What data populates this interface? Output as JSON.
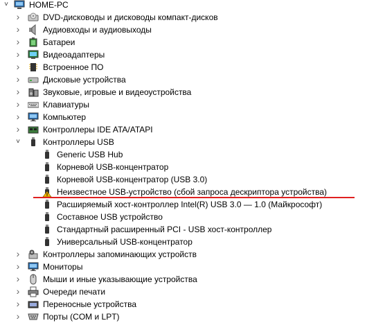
{
  "root": {
    "label": "HOME-PC",
    "icon": "computer-icon"
  },
  "categories_before": [
    {
      "label": "DVD-дисководы и дисководы компакт-дисков",
      "icon": "dvd-drive-icon"
    },
    {
      "label": "Аудиовходы и аудиовыходы",
      "icon": "speaker-icon"
    },
    {
      "label": "Батареи",
      "icon": "battery-icon"
    },
    {
      "label": "Видеоадаптеры",
      "icon": "display-adapter-icon"
    },
    {
      "label": "Встроенное ПО",
      "icon": "firmware-icon"
    },
    {
      "label": "Дисковые устройства",
      "icon": "disk-drive-icon"
    },
    {
      "label": "Звуковые, игровые и видеоустройства",
      "icon": "sound-icon"
    },
    {
      "label": "Клавиатуры",
      "icon": "keyboard-icon"
    },
    {
      "label": "Компьютер",
      "icon": "monitor-icon"
    },
    {
      "label": "Контроллеры IDE ATA/ATAPI",
      "icon": "ide-controller-icon"
    }
  ],
  "usb_category": {
    "label": "Контроллеры USB",
    "icon": "usb-icon"
  },
  "usb_children": [
    {
      "label": "Generic USB Hub",
      "icon": "usb-icon"
    },
    {
      "label": "Корневой USB-концентратор",
      "icon": "usb-icon"
    },
    {
      "label": "Корневой USB-концентратор (USB 3.0)",
      "icon": "usb-icon"
    },
    {
      "label": "Неизвестное USB-устройство (сбой запроса дескриптора устройства)",
      "icon": "usb-warning-icon"
    },
    {
      "label": "Расширяемый хост-контроллер Intel(R) USB 3.0 — 1.0 (Майкрософт)",
      "icon": "usb-icon"
    },
    {
      "label": "Составное USB устройство",
      "icon": "usb-icon"
    },
    {
      "label": "Стандартный расширенный PCI - USB хост-контроллер",
      "icon": "usb-icon"
    },
    {
      "label": "Универсальный USB-концентратор",
      "icon": "usb-icon"
    }
  ],
  "categories_after": [
    {
      "label": "Контроллеры запоминающих устройств",
      "icon": "storage-controller-icon"
    },
    {
      "label": "Мониторы",
      "icon": "monitor-icon"
    },
    {
      "label": "Мыши и иные указывающие устройства",
      "icon": "mouse-icon"
    },
    {
      "label": "Очереди печати",
      "icon": "printer-icon"
    },
    {
      "label": "Переносные устройства",
      "icon": "portable-device-icon"
    },
    {
      "label": "Порты (COM и LPT)",
      "icon": "port-icon"
    }
  ],
  "colors": {
    "annotation_line": "#e02020",
    "warning": "#f2b600"
  }
}
